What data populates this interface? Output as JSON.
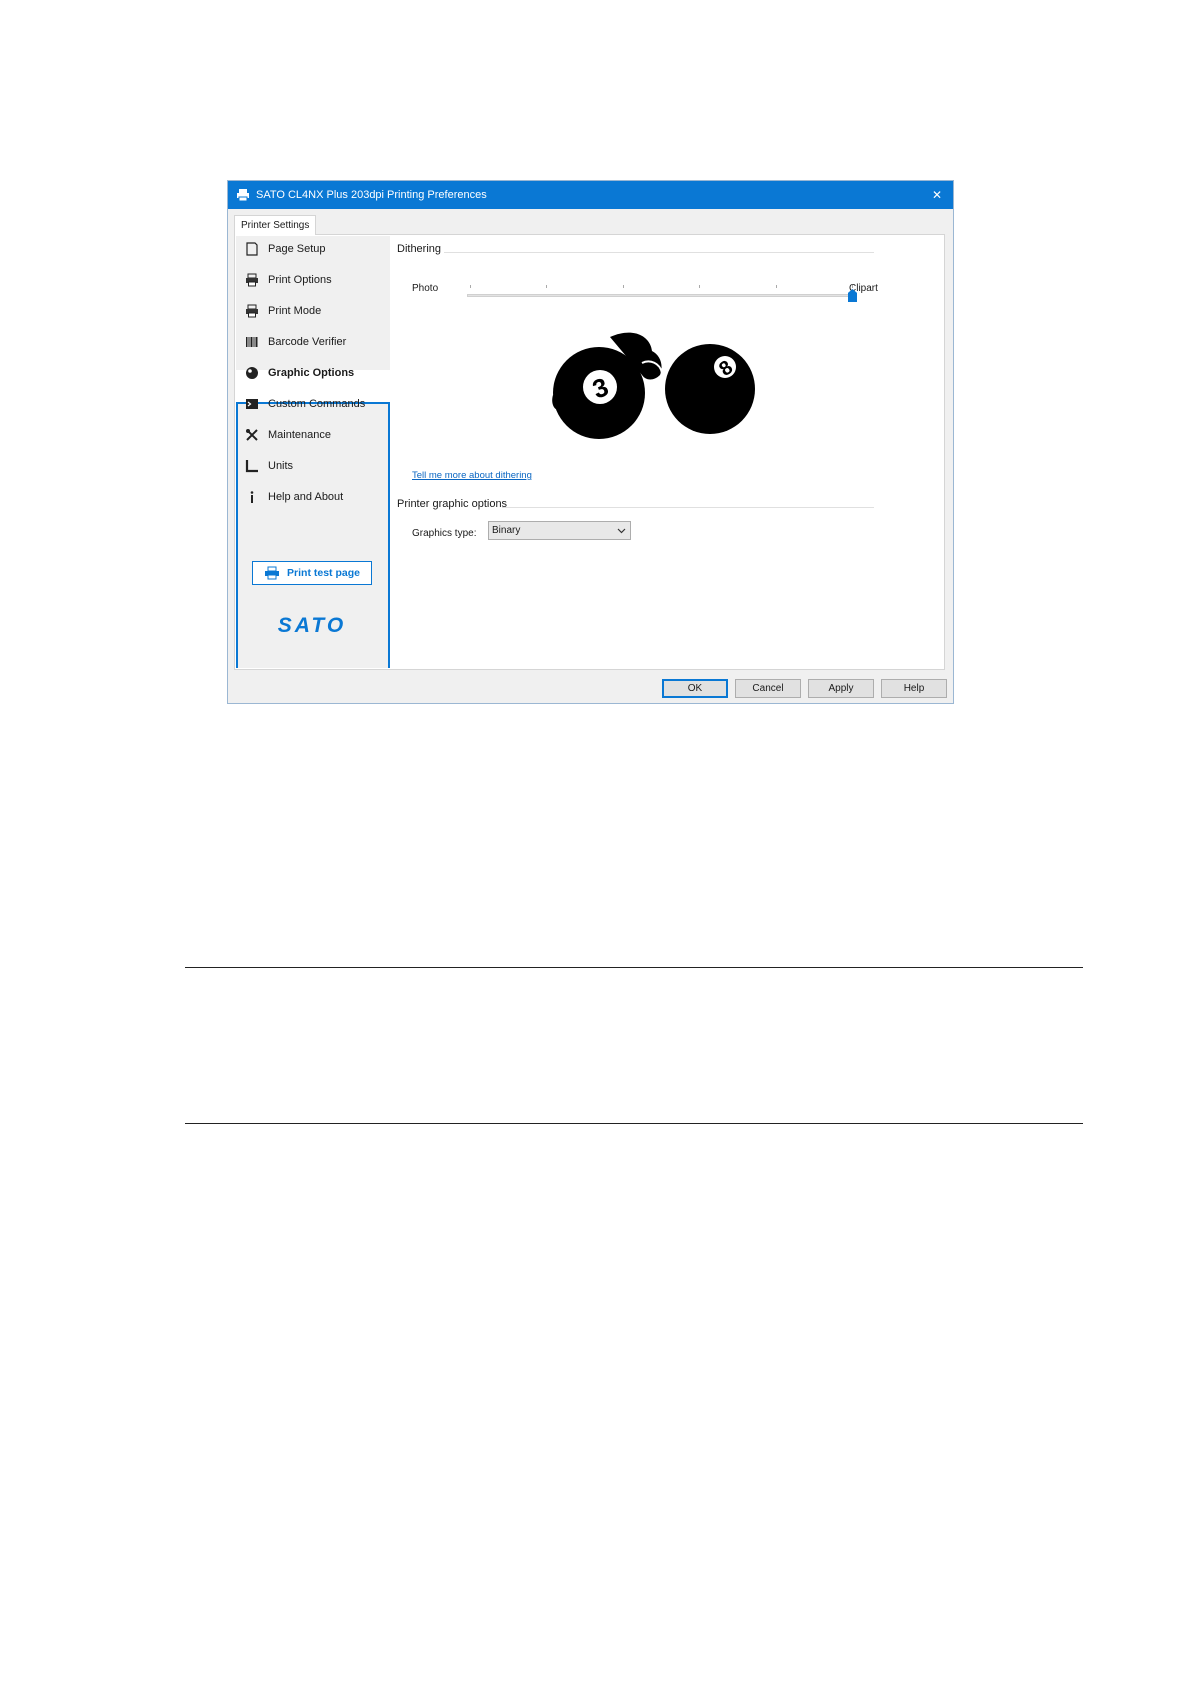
{
  "window": {
    "title": "SATO CL4NX Plus 203dpi Printing Preferences",
    "close_glyph": "✕",
    "accent_color": "#0a78d4"
  },
  "tab": {
    "label": "Printer Settings"
  },
  "sidebar": {
    "items": [
      {
        "label": "Page Setup",
        "icon": "page-icon"
      },
      {
        "label": "Print Options",
        "icon": "printer-icon"
      },
      {
        "label": "Print Mode",
        "icon": "printer-icon"
      },
      {
        "label": "Barcode Verifier",
        "icon": "barcode-icon"
      },
      {
        "label": "Graphic Options",
        "icon": "ball-icon",
        "active": true
      },
      {
        "label": "Custom Commands",
        "icon": "terminal-icon"
      },
      {
        "label": "Maintenance",
        "icon": "tools-icon"
      },
      {
        "label": "Units",
        "icon": "ruler-icon"
      },
      {
        "label": "Help and About",
        "icon": "info-icon"
      }
    ],
    "test_button": "Print test page",
    "logo_text": "SATO"
  },
  "dithering": {
    "title": "Dithering",
    "min_label": "Photo",
    "max_label": "Clipart",
    "slider_value": 1.0,
    "link": "Tell me more about dithering"
  },
  "graphic_options": {
    "title": "Printer graphic options",
    "type_label": "Graphics type:",
    "type_value": "Binary"
  },
  "buttons": {
    "ok": "OK",
    "cancel": "Cancel",
    "apply": "Apply",
    "help": "Help"
  }
}
